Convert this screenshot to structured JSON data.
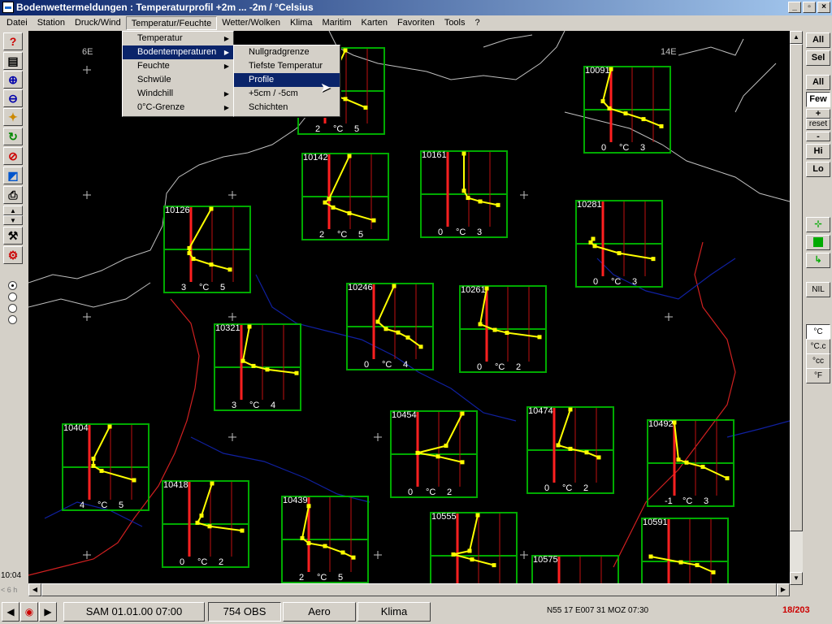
{
  "window": {
    "title": "Bodenwettermeldungen : Temperaturprofil +2m ... -2m  / °Celsius"
  },
  "menubar": [
    "Datei",
    "Station",
    "Druck/Wind",
    "Temperatur/Feuchte",
    "Wetter/Wolken",
    "Klima",
    "Maritim",
    "Karten",
    "Favoriten",
    "Tools",
    "?"
  ],
  "menu_temp": [
    {
      "label": "Temperatur",
      "submenu": true
    },
    {
      "label": "Bodentemperaturen",
      "submenu": true
    },
    {
      "label": "Feuchte",
      "submenu": true
    },
    {
      "label": "Schwüle",
      "submenu": false
    },
    {
      "label": "Windchill",
      "submenu": true
    },
    {
      "label": "0°C-Grenze",
      "submenu": true
    }
  ],
  "menu_boden": [
    "Nullgradgrenze",
    "Tiefste Temperatur",
    "Profile",
    "+5cm / -5cm",
    "Schichten"
  ],
  "map": {
    "lon_labels": [
      "6E",
      "14E"
    ]
  },
  "right_toolbar": [
    "All",
    "Sel",
    "All",
    "Few",
    "+",
    "reset",
    "-",
    "Hi",
    "Lo",
    "NIL",
    "°C",
    "°C.c",
    "°cc",
    "°F"
  ],
  "left_panel": {
    "time": "10:04",
    "step": "< 6 h"
  },
  "status": {
    "datetime": "SAM 01.01.00 07:00",
    "obs": "754 OBS",
    "aero": "Aero",
    "klima": "Klima",
    "coords": "N55 17 E007 31  MOZ 07:30",
    "counter": "18/203"
  },
  "stations": [
    {
      "id": "10091",
      "lo": "0",
      "unit": "°C",
      "hi": "3",
      "pts": [
        [
          0.3,
          0
        ],
        [
          0.2,
          0.45
        ],
        [
          0.28,
          0.55
        ],
        [
          0.48,
          0.62
        ],
        [
          0.7,
          0.7
        ],
        [
          0.92,
          0.8
        ]
      ]
    },
    {
      "id": "10142",
      "lo": "2",
      "unit": "°C",
      "hi": "5",
      "pts": [
        [
          0.55,
          0
        ],
        [
          0.3,
          0.6
        ],
        [
          0.25,
          0.65
        ],
        [
          0.35,
          0.72
        ],
        [
          0.55,
          0.8
        ],
        [
          0.85,
          0.9
        ]
      ]
    },
    {
      "id": "10161",
      "lo": "0",
      "unit": "°C",
      "hi": "3",
      "pts": [
        [
          0.5,
          0
        ],
        [
          0.5,
          0.52
        ],
        [
          0.55,
          0.62
        ],
        [
          0.7,
          0.67
        ],
        [
          0.92,
          0.72
        ]
      ]
    },
    {
      "id": "10126",
      "lo": "3",
      "unit": "°C",
      "hi": "5",
      "pts": [
        [
          0.55,
          0
        ],
        [
          0.28,
          0.55
        ],
        [
          0.28,
          0.62
        ],
        [
          0.33,
          0.7
        ],
        [
          0.55,
          0.78
        ],
        [
          0.78,
          0.85
        ]
      ]
    },
    {
      "id": "10281",
      "lo": "0",
      "unit": "°C",
      "hi": "3",
      "pts": [
        [
          0.18,
          0.5
        ],
        [
          0.15,
          0.55
        ],
        [
          0.2,
          0.6
        ],
        [
          0.5,
          0.7
        ],
        [
          0.92,
          0.78
        ]
      ]
    },
    {
      "id": "10246",
      "lo": "0",
      "unit": "°C",
      "hi": "4",
      "pts": [
        [
          0.55,
          0
        ],
        [
          0.35,
          0.5
        ],
        [
          0.45,
          0.6
        ],
        [
          0.6,
          0.65
        ],
        [
          0.72,
          0.72
        ],
        [
          0.88,
          0.85
        ]
      ]
    },
    {
      "id": "10261",
      "lo": "0",
      "unit": "°C",
      "hi": "2",
      "pts": [
        [
          0.3,
          0
        ],
        [
          0.22,
          0.5
        ],
        [
          0.4,
          0.58
        ],
        [
          0.55,
          0.62
        ],
        [
          0.95,
          0.68
        ]
      ]
    },
    {
      "id": "10321",
      "lo": "3",
      "unit": "°C",
      "hi": "4",
      "pts": [
        [
          0.4,
          0
        ],
        [
          0.32,
          0.48
        ],
        [
          0.45,
          0.55
        ],
        [
          0.62,
          0.6
        ],
        [
          0.98,
          0.65
        ]
      ]
    },
    {
      "id": "10404",
      "lo": "4",
      "unit": "°C",
      "hi": "5",
      "pts": [
        [
          0.55,
          0
        ],
        [
          0.35,
          0.45
        ],
        [
          0.35,
          0.55
        ],
        [
          0.45,
          0.62
        ],
        [
          0.85,
          0.75
        ]
      ]
    },
    {
      "id": "10418",
      "lo": "0",
      "unit": "°C",
      "hi": "2",
      "pts": [
        [
          0.58,
          0
        ],
        [
          0.45,
          0.45
        ],
        [
          0.4,
          0.55
        ],
        [
          0.55,
          0.6
        ],
        [
          0.95,
          0.66
        ]
      ]
    },
    {
      "id": "10439",
      "lo": "2",
      "unit": "°C",
      "hi": "5",
      "pts": [
        [
          0.3,
          0.1
        ],
        [
          0.22,
          0.55
        ],
        [
          0.3,
          0.62
        ],
        [
          0.5,
          0.66
        ],
        [
          0.72,
          0.75
        ],
        [
          0.85,
          0.82
        ]
      ]
    },
    {
      "id": "10454",
      "lo": "0",
      "unit": "°C",
      "hi": "2",
      "pts": [
        [
          0.85,
          0
        ],
        [
          0.65,
          0.45
        ],
        [
          0.3,
          0.55
        ],
        [
          0.55,
          0.6
        ],
        [
          0.85,
          0.68
        ]
      ]
    },
    {
      "id": "10474",
      "lo": "0",
      "unit": "°C",
      "hi": "2",
      "pts": [
        [
          0.5,
          0
        ],
        [
          0.35,
          0.5
        ],
        [
          0.5,
          0.55
        ],
        [
          0.7,
          0.6
        ],
        [
          0.85,
          0.67
        ]
      ]
    },
    {
      "id": "10492",
      "lo": "-1",
      "unit": "°C",
      "hi": "3",
      "pts": [
        [
          0.3,
          0
        ],
        [
          0.35,
          0.52
        ],
        [
          0.45,
          0.56
        ],
        [
          0.65,
          0.62
        ],
        [
          0.95,
          0.78
        ]
      ]
    },
    {
      "id": "10555",
      "lo": "",
      "unit": "",
      "hi": "",
      "pts": [
        [
          0.55,
          0
        ],
        [
          0.45,
          0.5
        ],
        [
          0.25,
          0.55
        ],
        [
          0.48,
          0.62
        ],
        [
          0.75,
          0.7
        ]
      ]
    },
    {
      "id": "10575",
      "lo": "",
      "unit": "",
      "hi": "",
      "pts": []
    },
    {
      "id": "10591",
      "lo": "",
      "unit": "",
      "hi": "",
      "pts": [
        [
          0.08,
          0.5
        ],
        [
          0.45,
          0.58
        ],
        [
          0.65,
          0.62
        ],
        [
          0.85,
          0.72
        ]
      ]
    },
    {
      "id": "",
      "lo": "2",
      "unit": "°C",
      "hi": "5",
      "pts": [
        [
          0.55,
          0
        ],
        [
          0.3,
          0.6
        ],
        [
          0.55,
          0.68
        ],
        [
          0.8,
          0.8
        ]
      ]
    }
  ]
}
